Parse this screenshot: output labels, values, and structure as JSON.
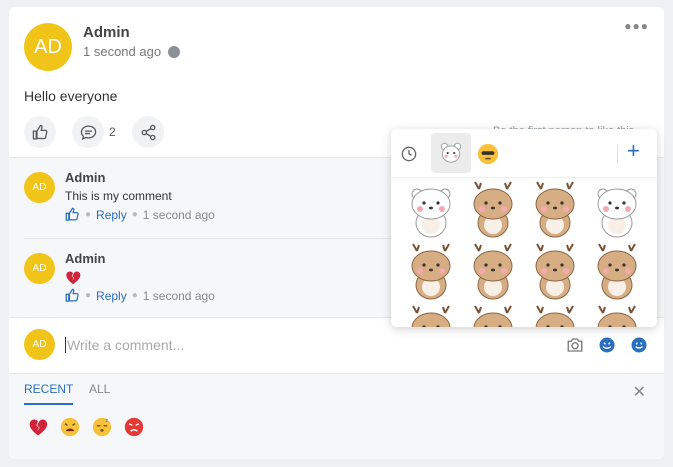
{
  "post": {
    "avatar_initials": "AD",
    "author": "Admin",
    "time": "1 second ago",
    "text": "Hello everyone",
    "comment_count": "2",
    "first_like": "Be the first person to like this"
  },
  "comments": [
    {
      "initials": "AD",
      "author": "Admin",
      "text": "This is my comment",
      "reply_label": "Reply",
      "time": "1 second ago"
    },
    {
      "initials": "AD",
      "author": "Admin",
      "text": "",
      "reply_label": "Reply",
      "time": "1 second ago"
    }
  ],
  "composer": {
    "initials": "AD",
    "placeholder": "Write a comment..."
  },
  "emoji_tray": {
    "tabs": [
      "RECENT",
      "ALL"
    ],
    "active_tab": "RECENT",
    "recent_icons": [
      "broken-heart-icon",
      "weary-face-icon",
      "sleepy-face-icon",
      "angry-face-icon"
    ]
  },
  "sticker_picker": {
    "packs": [
      "recent-clock-icon",
      "bear-pack-icon",
      "emoji-pack-icon"
    ],
    "stickers": [
      "bear-sticker",
      "deer-sticker",
      "deer-sticker",
      "bear-sticker",
      "deer-sticker",
      "deer-sticker",
      "deer-sticker",
      "deer-sticker",
      "deer-sticker",
      "deer-sticker",
      "deer-sticker",
      "deer-sticker"
    ]
  },
  "colors": {
    "accent": "#2b6ebd",
    "avatar": "#f0c419",
    "background": "#eef0f3"
  }
}
